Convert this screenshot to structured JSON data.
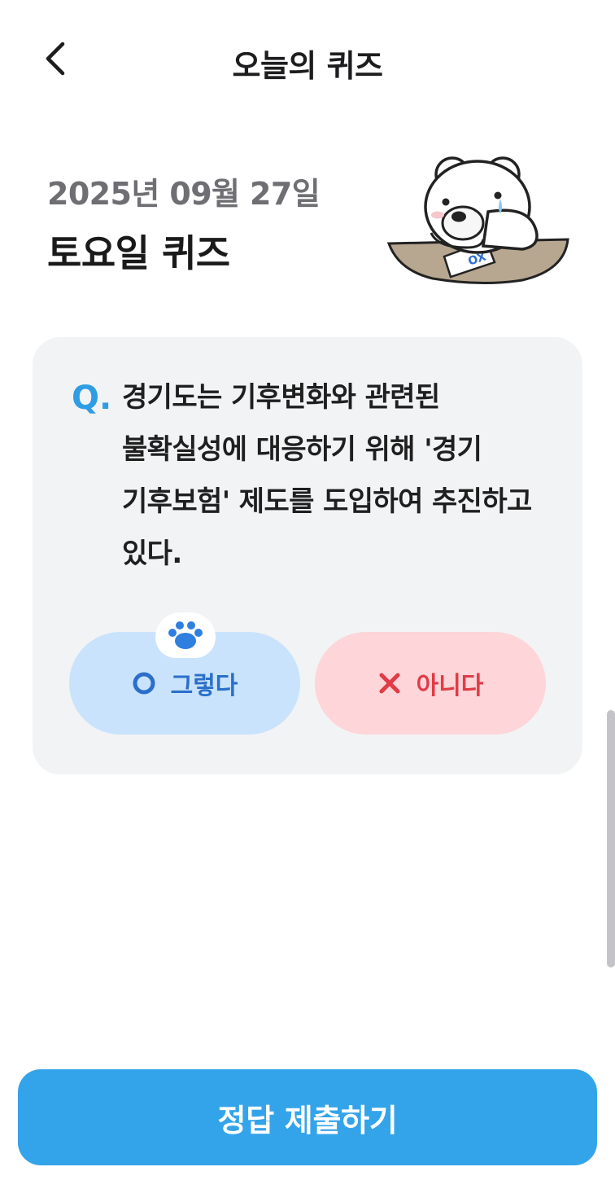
{
  "header": {
    "title": "오늘의 퀴즈",
    "back_icon": "chevron-left-icon"
  },
  "quiz": {
    "date": "2025년 09월 27일",
    "title": "토요일 퀴즈",
    "question_marker": "Q.",
    "question": "경기도는 기후변화와 관련된 불확실성에 대응하기 위해 '경기 기후보험' 제도를 도입하여 추진하고 있다.",
    "answers": {
      "yes": {
        "label": "그렇다",
        "icon": "circle-o-icon",
        "selected": true
      },
      "no": {
        "label": "아니다",
        "icon": "x-icon",
        "selected": false
      }
    },
    "mascot_card_text": "OX"
  },
  "footer": {
    "submit_label": "정답 제출하기"
  },
  "colors": {
    "accent": "#34a4ea",
    "question_marker": "#2f9de4",
    "yes_bg": "#c9e3fd",
    "yes_fg": "#2b6fc9",
    "no_bg": "#fed5d8",
    "no_fg": "#e03b46",
    "card_bg": "#f2f3f5"
  }
}
